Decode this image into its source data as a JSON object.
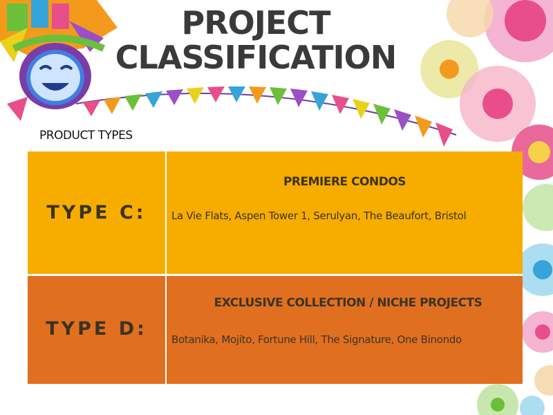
{
  "title": {
    "line1": "PROJECT",
    "line2": "CLASSIFICATION"
  },
  "section_label": "PRODUCT TYPES",
  "rows": [
    {
      "type_label": "TYPE C:",
      "heading": "PREMIERE CONDOS",
      "items": "La Vie Flats, Aspen Tower 1, Serulyan, The Beaufort, Bristol",
      "color": "#f7ad00"
    },
    {
      "type_label": "TYPE D:",
      "heading": "EXCLUSIVE COLLECTION / NICHE PROJECTS",
      "items": "Botanika, Mojito, Fortune Hill, The Signature, One Binondo",
      "color": "#e07020"
    }
  ],
  "icons": [
    "festival-mask-icon",
    "bunting-flags-icon",
    "flower-decoration-icon"
  ]
}
